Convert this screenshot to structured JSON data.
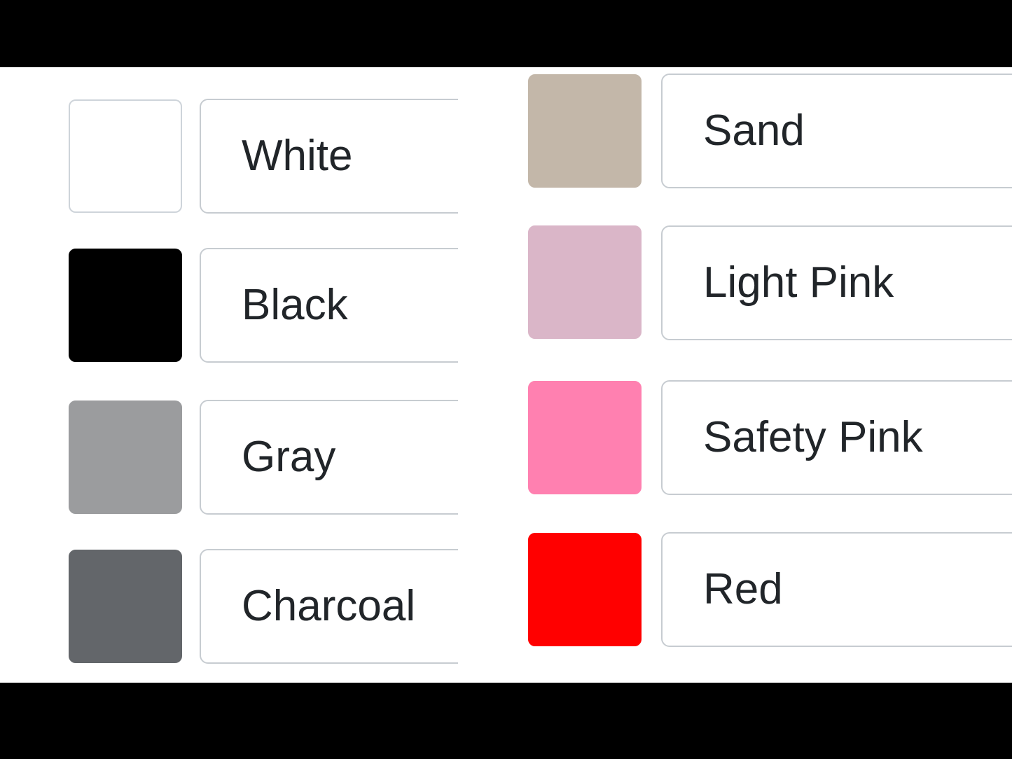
{
  "left_panel": {
    "colors": [
      {
        "name": "White",
        "hex": "#ffffff"
      },
      {
        "name": "Black",
        "hex": "#000000"
      },
      {
        "name": "Gray",
        "hex": "#9b9c9e"
      },
      {
        "name": "Charcoal",
        "hex": "#63666a"
      }
    ]
  },
  "right_panel": {
    "colors": [
      {
        "name": "Sand",
        "hex": "#c3b7a9"
      },
      {
        "name": "Light Pink",
        "hex": "#dab6c8"
      },
      {
        "name": "Safety Pink",
        "hex": "#ff80b0"
      },
      {
        "name": "Red",
        "hex": "#ff0000"
      }
    ]
  }
}
